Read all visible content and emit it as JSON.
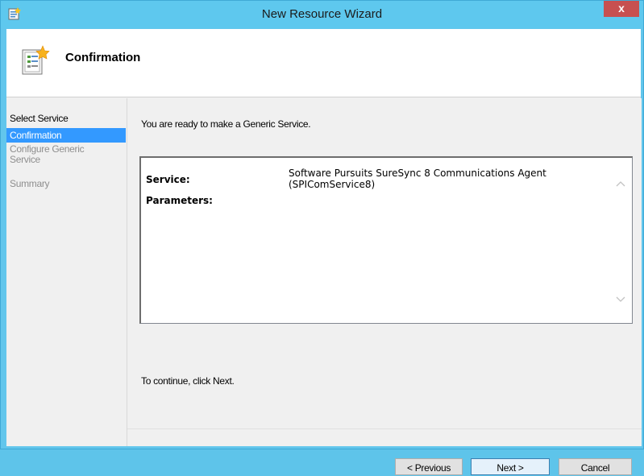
{
  "window": {
    "title": "New Resource Wizard",
    "close_label": "x"
  },
  "header": {
    "title": "Confirmation",
    "icon": "wizard-page-icon"
  },
  "sidebar": {
    "items": [
      {
        "label": "Select Service",
        "state": "normal"
      },
      {
        "label": "Confirmation",
        "state": "active"
      },
      {
        "label": "Configure Generic Service",
        "state": "disabled"
      },
      {
        "label": "Summary",
        "state": "disabled"
      }
    ]
  },
  "main": {
    "intro_text": "You are ready to make a Generic Service.",
    "summary": {
      "service_label": "Service:",
      "service_value": "Software Pursuits SureSync 8 Communications Agent (SPIComService8)",
      "parameters_label": "Parameters:",
      "parameters_value": ""
    },
    "continue_text": "To continue, click Next."
  },
  "buttons": {
    "previous": "< Previous",
    "next": "Next >",
    "cancel": "Cancel"
  },
  "colors": {
    "titlebar": "#5ec8ee",
    "close": "#c75050",
    "selection": "#3399ff"
  }
}
